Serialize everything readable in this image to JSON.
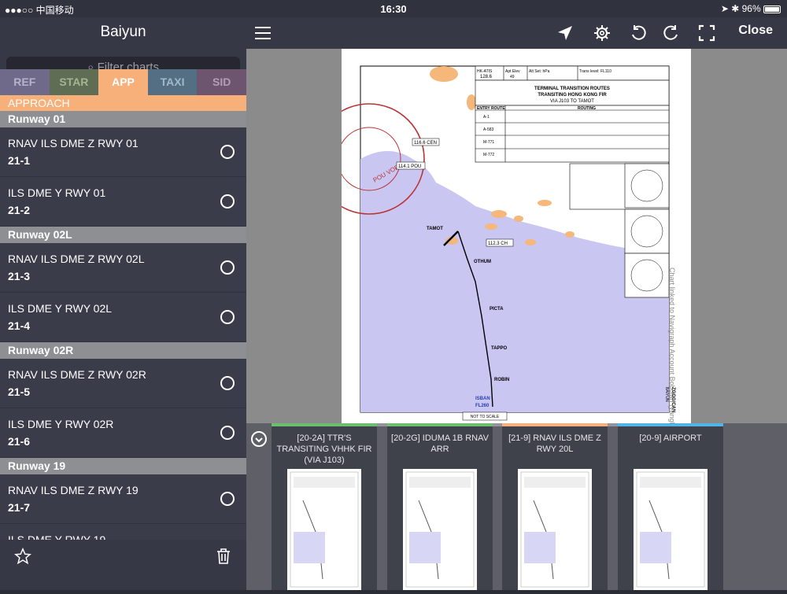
{
  "status": {
    "carrier": "●●●○○ 中国移动",
    "time": "16:30",
    "battery": "96%"
  },
  "sidebar": {
    "title": "Baiyun",
    "search_placeholder": "Filter charts",
    "tabs": [
      {
        "label": "REF",
        "color": "#6f6a89",
        "text_color": "#b7b2cc"
      },
      {
        "label": "STAR",
        "color": "#5f6d54",
        "text_color": "#a4b394"
      },
      {
        "label": "APP",
        "color": "#f8b07b",
        "text_color": "#ffffff"
      },
      {
        "label": "TAXI",
        "color": "#546f83",
        "text_color": "#a1b9cb"
      },
      {
        "label": "SID",
        "color": "#6d5570",
        "text_color": "#b39db6"
      }
    ],
    "category": "APPROACH",
    "groups": [
      {
        "runway": "Runway 01",
        "items": [
          {
            "name": "RNAV ILS DME Z RWY 01",
            "number": "21-1"
          },
          {
            "name": "ILS DME Y RWY 01",
            "number": "21-2"
          }
        ]
      },
      {
        "runway": "Runway 02L",
        "items": [
          {
            "name": "RNAV ILS DME Z RWY 02L",
            "number": "21-3"
          },
          {
            "name": "ILS DME Y RWY 02L",
            "number": "21-4"
          }
        ]
      },
      {
        "runway": "Runway 02R",
        "items": [
          {
            "name": "RNAV ILS DME Z RWY 02R",
            "number": "21-5"
          },
          {
            "name": "ILS DME Y RWY 02R",
            "number": "21-6"
          }
        ]
      },
      {
        "runway": "Runway 19",
        "items": [
          {
            "name": "RNAV ILS DME Z RWY 19",
            "number": "21-7"
          },
          {
            "name": "ILS DME Y RWY 19",
            "number": ""
          }
        ]
      }
    ]
  },
  "toolbar": {
    "close_label": "Close"
  },
  "chart": {
    "title_lines": [
      "TERMINAL TRANSITION ROUTES",
      "TRANSITING HONG KONG FIR",
      "VIA J103 TO TAMOT"
    ],
    "header_cells": [
      "HK-ATIS",
      "128.6",
      "Apt Elev",
      "49",
      "Alt Set: hPa",
      "Trans level: FL110"
    ],
    "entry_cols": [
      "ENTRY ROUTE",
      "ROUTING"
    ],
    "entry_rows": [
      "A-1",
      "A-583",
      "M-771",
      "M-772"
    ],
    "waypoints": [
      "TAMOT",
      "OTHUM",
      "PICTA",
      "TAPPO",
      "ROBIN",
      "ISBAN",
      "FL260"
    ],
    "freq_labels": [
      "116.6 CEN",
      "112.3 CH",
      "114.1 POU"
    ],
    "vor_label": "POU VOR",
    "side_text": "Chart linked to Navigraph Account Bobojan (yangbojun@hotmail.com).",
    "scale_note": "NOT TO SCALE",
    "airport_code": "ZGGG/CAN",
    "airport_name": "BAIYUN"
  },
  "recents": [
    {
      "title": "[20-2A] TTR'S TRANSITING VHHK FIR (VIA J103)",
      "color": "#6cbf6c"
    },
    {
      "title": "[20-2G] IDUMA 1B RNAV ARR",
      "color": "#6cbf6c"
    },
    {
      "title": "[21-9] RNAV ILS DME Z RWY 20L",
      "color": "#f8b07b"
    },
    {
      "title": "[20-9] AIRPORT",
      "color": "#4fb4e8"
    }
  ]
}
